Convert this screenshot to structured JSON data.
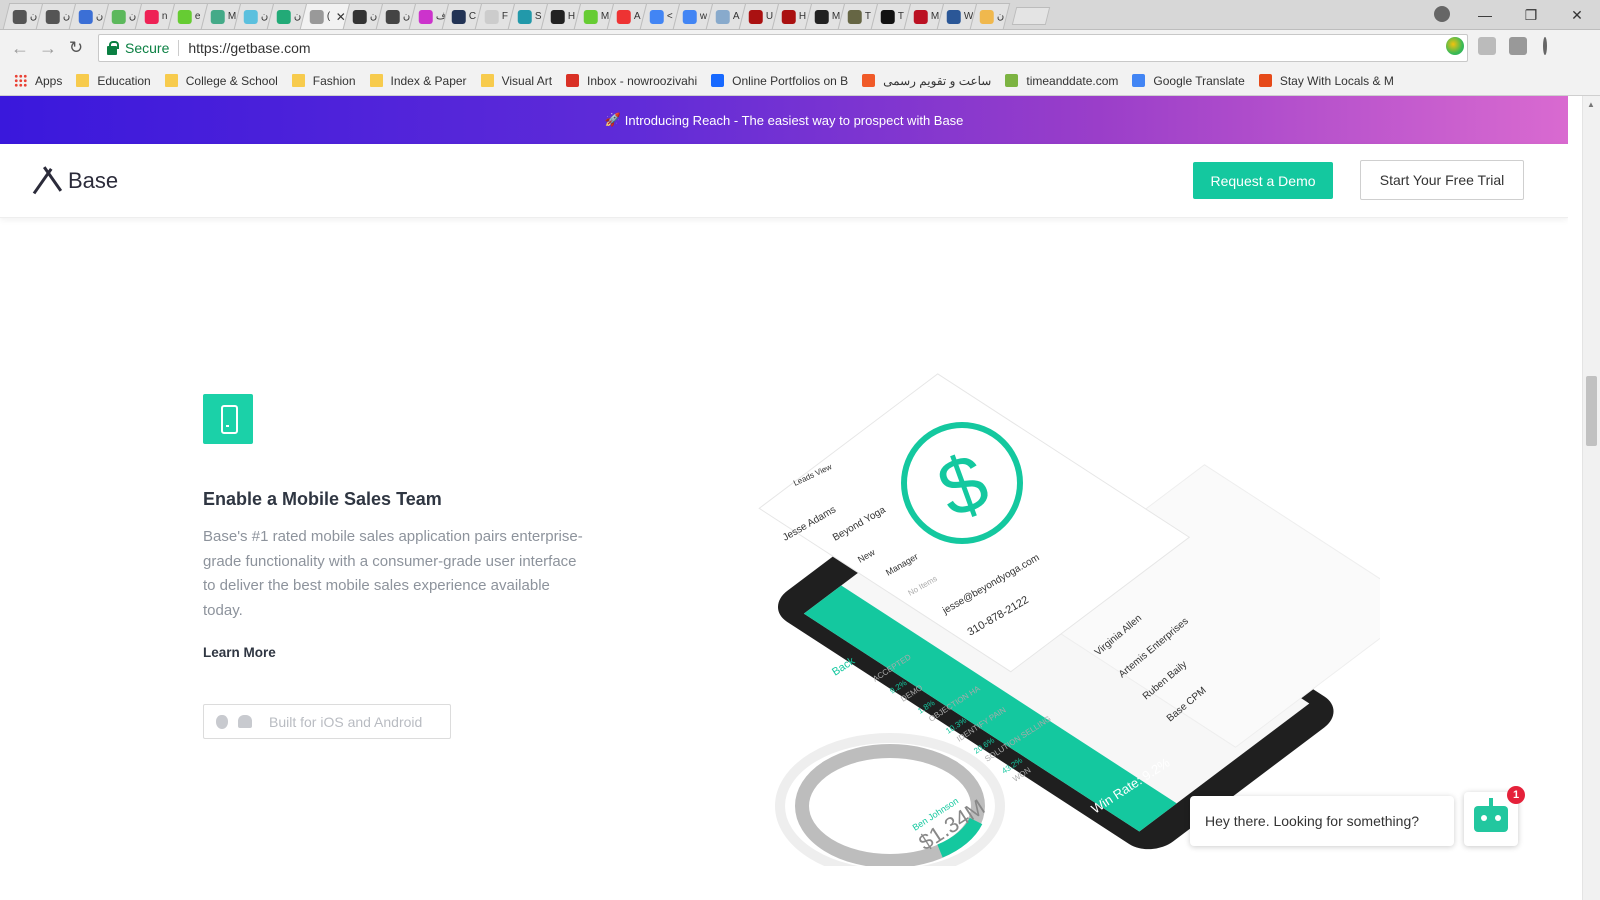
{
  "browser": {
    "tabs": [
      {
        "label": "ن",
        "color": "#555"
      },
      {
        "label": "ن",
        "color": "#555"
      },
      {
        "label": "ن",
        "color": "#3b6fd6"
      },
      {
        "label": "ن",
        "color": "#5cb85c"
      },
      {
        "label": "n",
        "color": "#e25"
      },
      {
        "label": "e",
        "color": "#6c3"
      },
      {
        "label": "M",
        "color": "#4a8"
      },
      {
        "label": "ن",
        "color": "#5bc0de"
      },
      {
        "label": "ن",
        "color": "#2a7"
      },
      {
        "label": "(1",
        "color": "#999",
        "active": true
      },
      {
        "label": "ن",
        "color": "#333"
      },
      {
        "label": "ن",
        "color": "#444"
      },
      {
        "label": "ف",
        "color": "#c3c"
      },
      {
        "label": "C",
        "color": "#235"
      },
      {
        "label": "F",
        "color": "#ccc"
      },
      {
        "label": "S",
        "color": "#29a"
      },
      {
        "label": "H",
        "color": "#222"
      },
      {
        "label": "M",
        "color": "#6c3"
      },
      {
        "label": "A",
        "color": "#e33"
      },
      {
        "label": "<",
        "color": "#4285f4"
      },
      {
        "label": "w",
        "color": "#4285f4"
      },
      {
        "label": "A",
        "color": "#8ac"
      },
      {
        "label": "U",
        "color": "#a11"
      },
      {
        "label": "H",
        "color": "#a11"
      },
      {
        "label": "M",
        "color": "#222"
      },
      {
        "label": "T",
        "color": "#664"
      },
      {
        "label": "T",
        "color": "#111"
      },
      {
        "label": "M",
        "color": "#b12"
      },
      {
        "label": "W",
        "color": "#2b5797"
      },
      {
        "label": "ن",
        "color": "#f0b84d"
      }
    ],
    "close_glyph": "✕",
    "window_controls": {
      "minimize": "—",
      "restore": "❐",
      "close": "✕"
    },
    "nav": {
      "back": "←",
      "forward": "→",
      "reload": "↻"
    },
    "secure_label": "Secure",
    "url": "https://getbase.com",
    "star": "☆",
    "bookmarks": [
      {
        "label": "Apps",
        "icon": "apps-icon"
      },
      {
        "label": "Education",
        "icon": "folder-icon"
      },
      {
        "label": "College & School",
        "icon": "folder-icon"
      },
      {
        "label": "Fashion",
        "icon": "folder-icon"
      },
      {
        "label": "Index & Paper",
        "icon": "folder-icon"
      },
      {
        "label": "Visual Art",
        "icon": "folder-icon"
      },
      {
        "label": "Inbox - nowroozivahi",
        "icon": "gmail-icon",
        "color": "#d93025"
      },
      {
        "label": "Online Portfolios on B",
        "icon": "behance-icon",
        "color": "#1769ff"
      },
      {
        "label": "ساعت و تقویم رسمی",
        "icon": "t-icon",
        "color": "#f05a28"
      },
      {
        "label": "timeanddate.com",
        "icon": "dots-icon",
        "color": "#7cb342"
      },
      {
        "label": "Google Translate",
        "icon": "translate-icon",
        "color": "#4285f4"
      },
      {
        "label": "Stay With Locals & M",
        "icon": "couchsurfing-icon",
        "color": "#e64a19"
      }
    ]
  },
  "site": {
    "banner_icon": "🚀",
    "banner_text": "Introducing Reach - The easiest way to prospect with Base",
    "logo_text": "Base",
    "request_demo": "Request a Demo",
    "free_trial": "Start Your Free Trial",
    "feature": {
      "title": "Enable a Mobile Sales Team",
      "description": "Base's #1 rated mobile sales application pairs enterprise-grade functionality with a consumer-grade user interface to deliver the best mobile sales experience available today.",
      "learn_more": "Learn More",
      "platform": "Built for iOS and Android"
    },
    "illustration": {
      "lead_name": "Jesse Adams",
      "company": "Beyond Yoga",
      "status": "New",
      "title_role": "Manager",
      "assoc": "No Items",
      "email": "jesse@beyondyoga.com",
      "phone": "310-878-2122",
      "header": "Leads View",
      "contacts": [
        "Virginia Allen",
        "Artemis Enterprises",
        "Ruben Baily",
        "Base CPM"
      ],
      "funnel": [
        "ACCEPTED",
        "DEMO",
        "OBJECTION HA",
        "IDENTIFY PAIN",
        "SOLUTION SELLING",
        "WON"
      ],
      "funnel_pct": [
        "9.2%",
        "1.8%",
        "10.3%",
        "20.6%",
        "43.2%"
      ],
      "win_rate": "Win Rate: 9.2%",
      "rep": "Ben Johnson",
      "amount": "$1.34M",
      "back": "Back",
      "dollar": "$"
    },
    "chat": {
      "prompt": "Hey there. Looking for something?",
      "badge": "1"
    }
  },
  "colors": {
    "accent": "#14c89f",
    "banner_start": "#3a18dc",
    "banner_end": "#d96ad0",
    "secure": "#0b8043"
  }
}
